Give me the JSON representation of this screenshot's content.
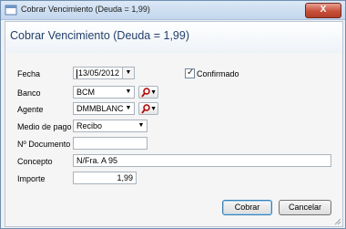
{
  "window": {
    "title": "Cobrar Vencimiento (Deuda = 1,99)",
    "close_symbol": "X",
    "icon": "app-window-icon"
  },
  "header": {
    "title": "Cobrar Vencimiento (Deuda = 1,99)"
  },
  "form": {
    "fecha": {
      "label": "Fecha",
      "value": "13/05/2012"
    },
    "confirmado": {
      "label": "Confirmado",
      "checked": true
    },
    "banco": {
      "label": "Banco",
      "value": "BCM"
    },
    "agente": {
      "label": "Agente",
      "value": "DMMBLANC"
    },
    "medio_pago": {
      "label": "Medio de pago",
      "value": "Recibo"
    },
    "documento": {
      "label": "Nº Documento",
      "value": ""
    },
    "concepto": {
      "label": "Concepto",
      "value": "N/Fra. A 95"
    },
    "importe": {
      "label": "Importe",
      "value": "1,99"
    }
  },
  "buttons": {
    "cobrar": "Cobrar",
    "cancelar": "Cancelar"
  },
  "colors": {
    "header_title": "#233f6b",
    "close_button": "#c8503a",
    "default_button_border": "#3c7fb1"
  }
}
